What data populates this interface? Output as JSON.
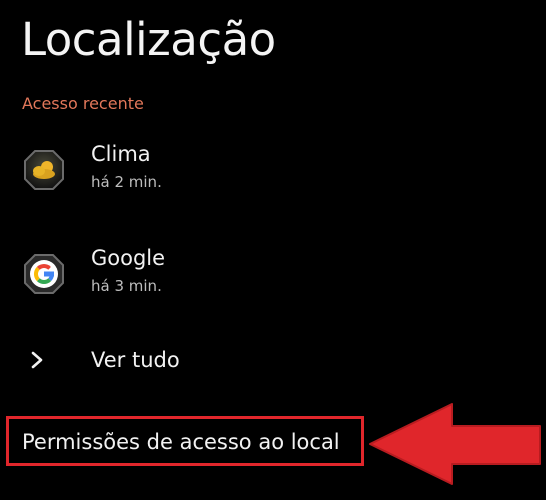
{
  "page": {
    "title": "Localização"
  },
  "recent_access": {
    "header": "Acesso recente",
    "items": [
      {
        "name": "Clima",
        "time": "há 2 min.",
        "icon": "weather-app-icon"
      },
      {
        "name": "Google",
        "time": "há 3 min.",
        "icon": "google-app-icon"
      }
    ],
    "see_all_label": "Ver tudo"
  },
  "permissions": {
    "label": "Permissões de acesso ao local"
  },
  "annotation": {
    "highlight_color": "#e0262b",
    "arrow_color": "#e0262b",
    "arrow_icon": "arrow-left-icon"
  },
  "colors": {
    "background": "#000000",
    "accent": "#e2775a",
    "primary_text": "#f2f2f2",
    "secondary_text": "#bdbdbd"
  }
}
